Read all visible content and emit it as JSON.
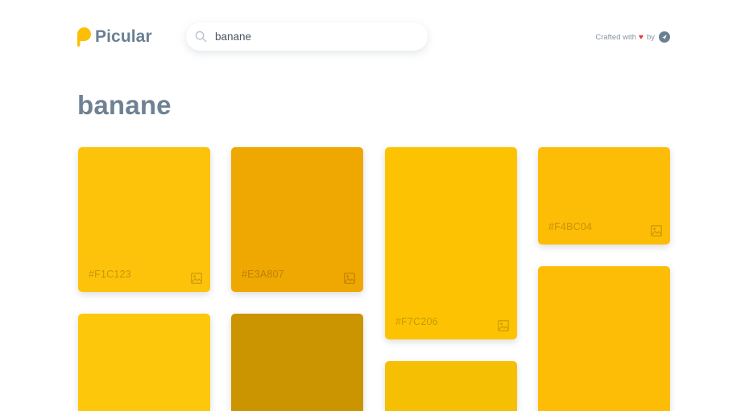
{
  "header": {
    "logo_text": "Picular",
    "logo_color": "#FDBE08",
    "search": {
      "value": "banane",
      "placeholder": "Search"
    },
    "credits": {
      "crafted": "Crafted with",
      "heart": "♥",
      "by": "by",
      "heart_color": "#E33B3B",
      "badge_color": "#6B7F93"
    }
  },
  "main": {
    "title": "banane"
  },
  "cards": [
    {
      "hex": "#F1C123",
      "color": "#FDC20A",
      "show_label": true
    },
    {
      "hex": "#E3A807",
      "color": "#EFA702",
      "show_label": true
    },
    {
      "hex": "#F7C206",
      "color": "#FDC302",
      "show_label": true
    },
    {
      "hex": "#F4BC04",
      "color": "#FDBC06",
      "show_label": true
    },
    {
      "hex": "",
      "color": "#FDC70B",
      "show_label": false
    },
    {
      "hex": "",
      "color": "#CA9500",
      "show_label": false
    },
    {
      "hex": "",
      "color": "#F5BF03",
      "show_label": false
    },
    {
      "hex": "",
      "color": "#FDBC06",
      "show_label": false
    }
  ]
}
